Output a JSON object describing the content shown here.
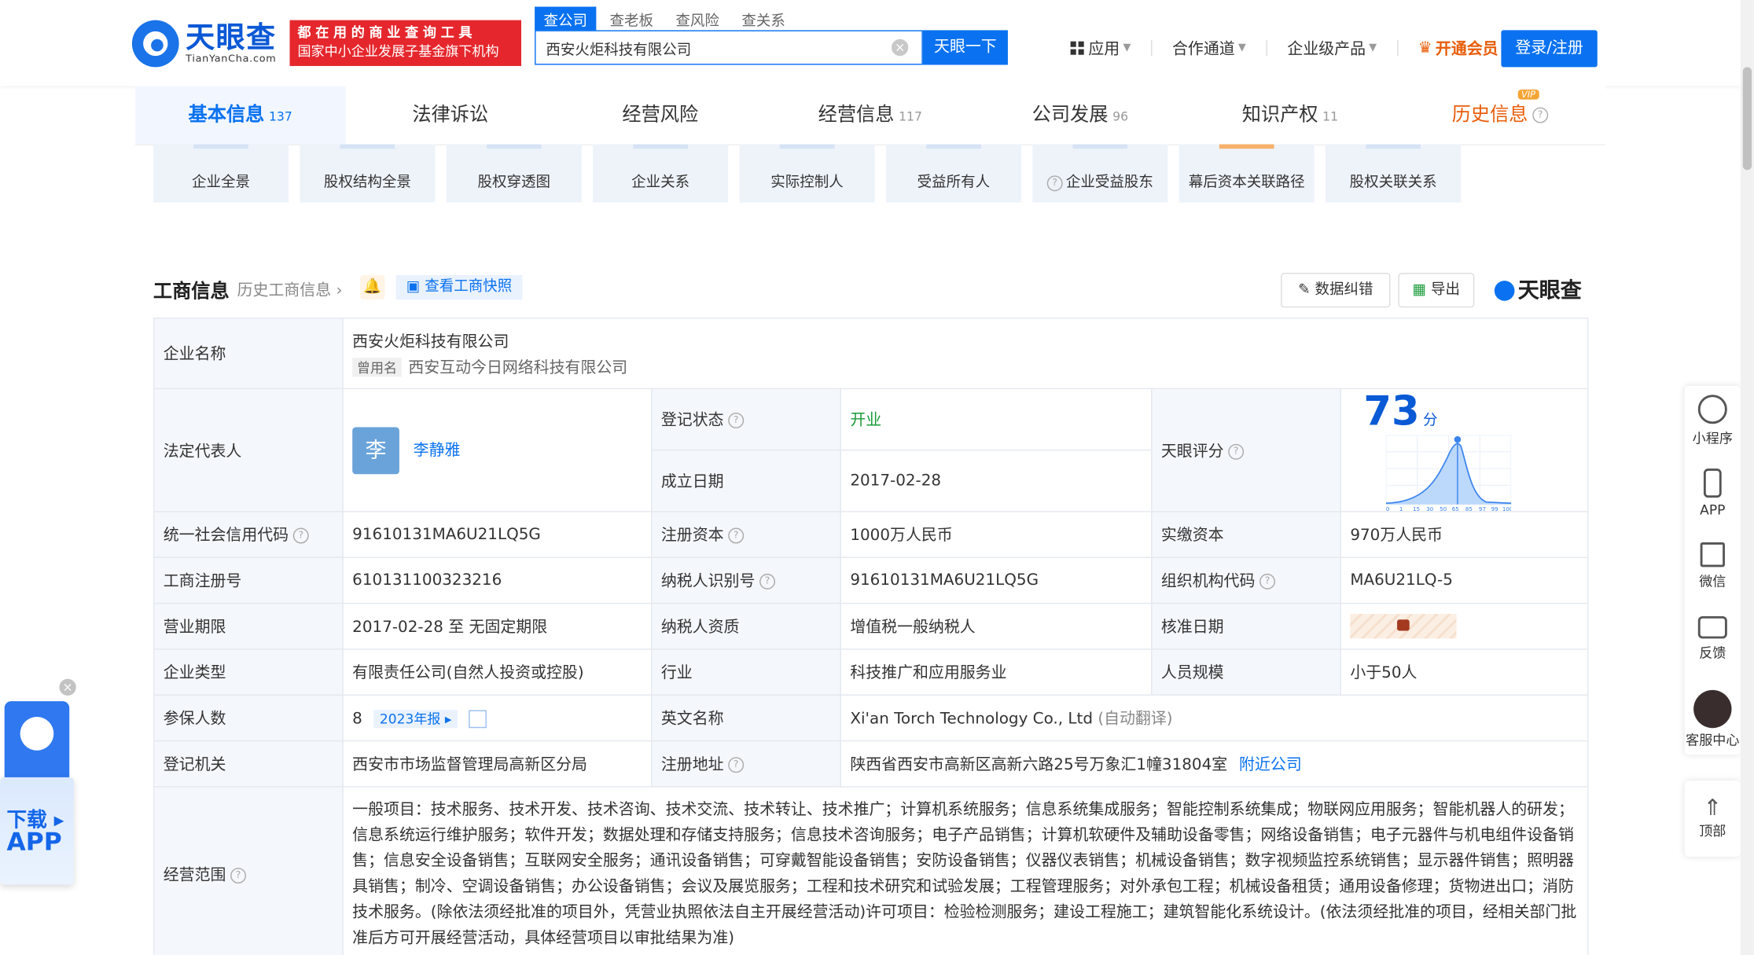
{
  "header": {
    "logo_cn": "天眼查",
    "logo_en": "TianYanCha.com",
    "slogan_line1": "都在用的商业查询工具",
    "slogan_line2": "国家中小企业发展子基金旗下机构",
    "search_tabs": [
      "查公司",
      "查老板",
      "查风险",
      "查关系"
    ],
    "search_value": "西安火炬科技有限公司",
    "search_button": "天眼一下",
    "nav": {
      "apps": "应用",
      "partner": "合作通道",
      "enterprise": "企业级产品",
      "vip": "开通会员"
    },
    "login": "登录/注册"
  },
  "tabs": [
    {
      "label": "基本信息",
      "count": "137"
    },
    {
      "label": "法律诉讼",
      "count": ""
    },
    {
      "label": "经营风险",
      "count": ""
    },
    {
      "label": "经营信息",
      "count": "117"
    },
    {
      "label": "公司发展",
      "count": "96"
    },
    {
      "label": "知识产权",
      "count": "11"
    },
    {
      "label": "历史信息",
      "count": ""
    }
  ],
  "vip_tag": "VIP",
  "graph_cards": [
    "企业全景",
    "股权结构全景",
    "股权穿透图",
    "企业关系",
    "实际控制人",
    "受益所有人",
    "企业受益股东",
    "幕后资本关联路径",
    "股权关联关系"
  ],
  "section": {
    "title": "工商信息",
    "history_link": "历史工商信息",
    "snapshot_btn": "查看工商快照",
    "correct_btn": "数据纠错",
    "export_btn": "导出",
    "brand": "天眼查"
  },
  "company": {
    "name_label": "企业名称",
    "name": "西安火炬科技有限公司",
    "former_tag": "曾用名",
    "former_name": "西安互动今日网络科技有限公司",
    "legal_rep_label": "法定代表人",
    "legal_rep_avatar": "李",
    "legal_rep": "李静雅",
    "status_label": "登记状态",
    "status": "开业",
    "found_label": "成立日期",
    "found": "2017-02-28",
    "score_label": "天眼评分",
    "score": "73",
    "score_unit": "分",
    "credit_label": "统一社会信用代码",
    "credit": "91610131MA6U21LQ5G",
    "capital_label": "注册资本",
    "capital": "1000万人民币",
    "paid_label": "实缴资本",
    "paid": "970万人民币",
    "reg_no_label": "工商注册号",
    "reg_no": "610131100323216",
    "taxid_label": "纳税人识别号",
    "taxid": "91610131MA6U21LQ5G",
    "org_label": "组织机构代码",
    "org": "MA6U21LQ-5",
    "term_label": "营业期限",
    "term": "2017-02-28 至 无固定期限",
    "taxq_label": "纳税人资质",
    "taxq": "增值税一般纳税人",
    "approve_label": "核准日期",
    "type_label": "企业类型",
    "type": "有限责任公司(自然人投资或控股)",
    "industry_label": "行业",
    "industry": "科技推广和应用服务业",
    "staff_label": "人员规模",
    "staff": "小于50人",
    "insured_label": "参保人数",
    "insured": "8",
    "insured_report": "2023年报",
    "en_label": "英文名称",
    "en_name": "Xi'an Torch Technology Co., Ltd",
    "en_note": "(自动翻译)",
    "authority_label": "登记机关",
    "authority": "西安市市场监督管理局高新区分局",
    "address_label": "注册地址",
    "address": "陕西省西安市高新区高新六路25号万象汇1幢31804室",
    "nearby": "附近公司",
    "scope_label": "经营范围",
    "scope": "一般项目：技术服务、技术开发、技术咨询、技术交流、技术转让、技术推广；计算机系统服务；信息系统集成服务；智能控制系统集成；物联网应用服务；智能机器人的研发；信息系统运行维护服务；软件开发；数据处理和存储支持服务；信息技术咨询服务；电子产品销售；计算机软硬件及辅助设备零售；网络设备销售；电子元器件与机电组件设备销售；信息安全设备销售；互联网安全服务；通讯设备销售；可穿戴智能设备销售；安防设备销售；仪器仪表销售；机械设备销售；数字视频监控系统销售；显示器件销售；照明器具销售；制冷、空调设备销售；办公设备销售；会议及展览服务；工程和技术研究和试验发展；工程管理服务；对外承包工程；机械设备租赁；通用设备修理；货物进出口；消防技术服务。(除依法须经批准的项目外，凭营业执照依法自主开展经营活动)许可项目：检验检测服务；建设工程施工；建筑智能化系统设计。(依法须经批准的项目，经相关部门批准后方可开展经营活动，具体经营项目以审批结果为准)"
  },
  "score_chart": {
    "x_ticks": [
      "0",
      "1",
      "15",
      "30",
      "50",
      "65",
      "85",
      "97",
      "99",
      "100"
    ]
  },
  "sidebar": [
    "小程序",
    "APP",
    "微信",
    "反馈",
    "客服中心"
  ],
  "to_top": "顶部",
  "download": {
    "line1": "下载",
    "line2": "APP"
  }
}
